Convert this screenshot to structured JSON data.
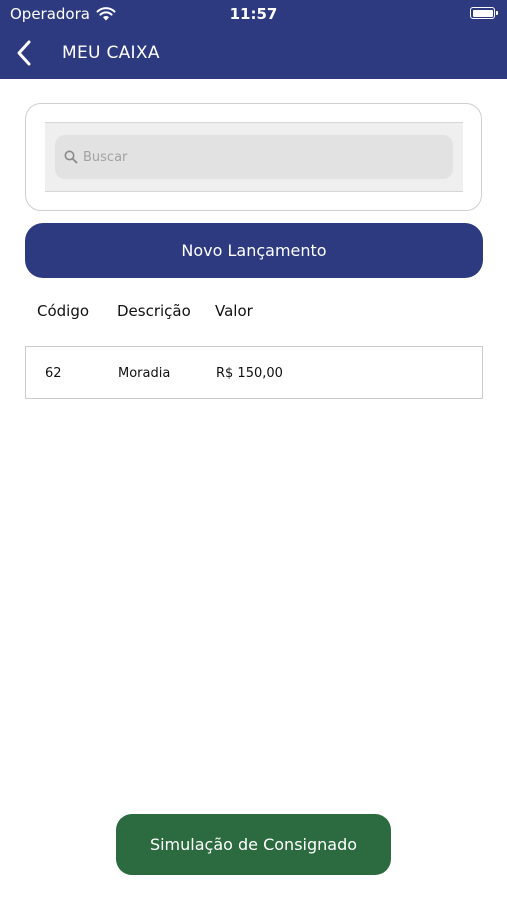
{
  "status_bar": {
    "carrier": "Operadora",
    "time": "11:57"
  },
  "nav": {
    "title": "MEU CAIXA"
  },
  "search": {
    "placeholder": "Buscar",
    "value": ""
  },
  "actions": {
    "new_entry_label": "Novo Lançamento",
    "simulation_label": "Simulação de Consignado"
  },
  "table": {
    "columns": [
      "Código",
      "Descrição",
      "Valor"
    ],
    "rows": [
      {
        "code": "62",
        "description": "Moradia",
        "value": "R$ 150,00"
      }
    ]
  },
  "colors": {
    "header_blue": "#2d3a80",
    "button_green": "#2c6a3f"
  },
  "icons": [
    "wifi-icon",
    "battery-icon",
    "back-icon",
    "search-icon"
  ]
}
